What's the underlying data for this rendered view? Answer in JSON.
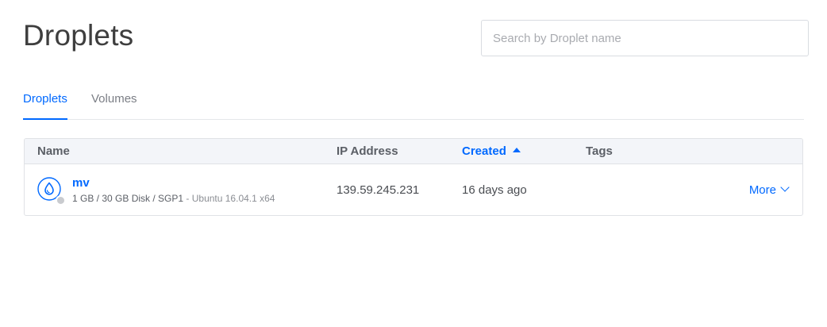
{
  "page": {
    "title": "Droplets"
  },
  "search": {
    "placeholder": "Search by Droplet name",
    "value": ""
  },
  "tabs": [
    {
      "label": "Droplets",
      "active": true
    },
    {
      "label": "Volumes",
      "active": false
    }
  ],
  "table": {
    "headers": {
      "name": "Name",
      "ip": "IP Address",
      "created": "Created",
      "tags": "Tags"
    },
    "sort": {
      "column": "created",
      "direction": "ascending"
    },
    "rows": [
      {
        "icon": "droplet-icon",
        "status": "off",
        "name": "mv",
        "specs": "1 GB / 30 GB Disk / SGP1",
        "os": " - Ubuntu 16.04.1 x64",
        "ip": "139.59.245.231",
        "created": "16 days ago",
        "tags": "",
        "more_label": "More"
      }
    ]
  },
  "colors": {
    "accent": "#0069ff",
    "header_bg": "#f3f5f9",
    "border": "#e0e2e6",
    "status_off": "#c9cbcf"
  }
}
